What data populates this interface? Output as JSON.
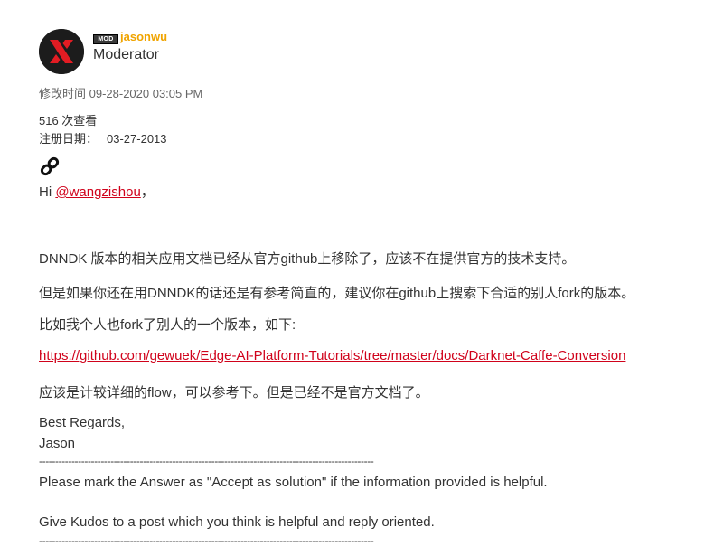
{
  "author": {
    "badge": "MOD",
    "username": "jasonwu",
    "rank": "Moderator"
  },
  "meta": {
    "modified": "修改时间 09-28-2020 03:05 PM",
    "views": "516 次查看",
    "registered_label": "注册日期：",
    "registered_value": "03-27-2013"
  },
  "icons": {
    "avatar": "xilinx-logo-avatar",
    "permalink": "link-icon"
  },
  "post": {
    "greeting_prefix": "Hi ",
    "mention": "@wangzishou",
    "greeting_suffix": "，",
    "p1": "DNNDK 版本的相关应用文档已经从官方github上移除了，应该不在提供官方的技术支持。",
    "p2": "但是如果你还在用DNNDK的话还是有参考简直的，建议你在github上搜索下合适的别人fork的版本。",
    "p3": "比如我个人也fork了别人的一个版本，如下:",
    "url": "https://github.com/gewuek/Edge-AI-Platform-Tutorials/tree/master/docs/Darknet-Caffe-Conversion",
    "p4": "应该是计较详细的flow，可以参考下。但是已经不是官方文档了。",
    "regards": "Best Regards,",
    "name": "Jason",
    "divider": "-------------------------------------------------------------------------------------------------------",
    "note1": "Please mark the Answer as \"Accept as solution\" if the information provided is helpful.",
    "note2": "Give Kudos to a post which you think is helpful and reply oriented."
  },
  "colors": {
    "link": "#d0021b",
    "username": "#f0a400",
    "text": "#333333",
    "meta": "#666666"
  }
}
